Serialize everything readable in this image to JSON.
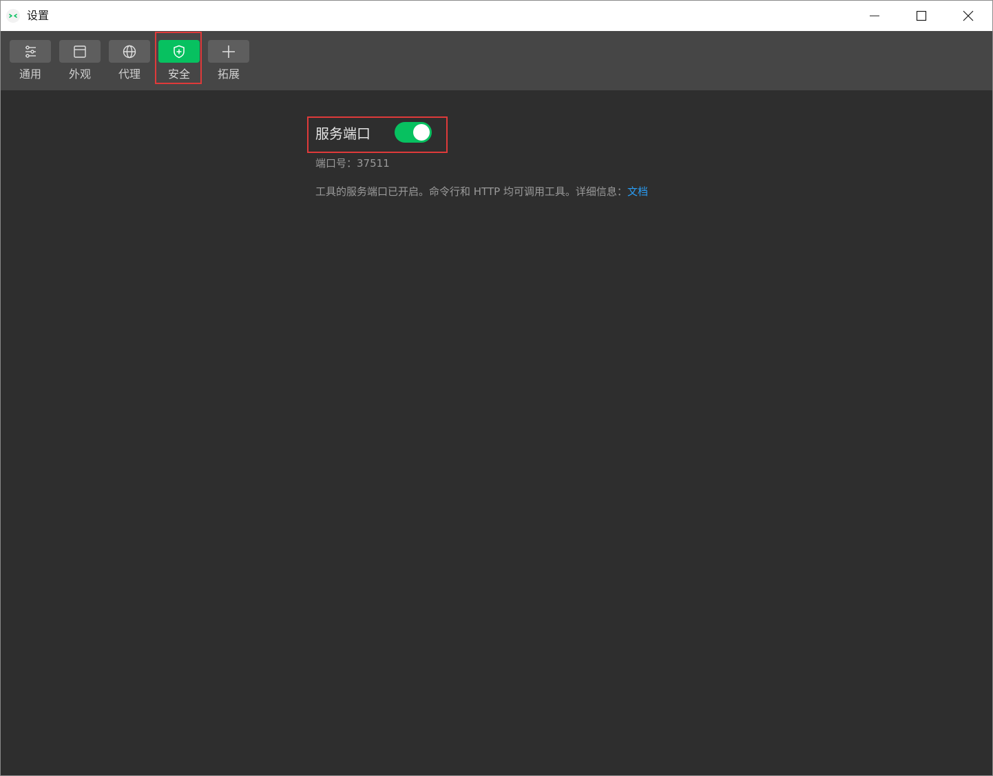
{
  "window": {
    "title": "设置",
    "app_icon": "wechat-devtools-icon"
  },
  "toolbar": {
    "tabs": [
      {
        "label": "通用",
        "icon": "sliders-icon",
        "active": false
      },
      {
        "label": "外观",
        "icon": "window-icon",
        "active": false
      },
      {
        "label": "代理",
        "icon": "globe-icon",
        "active": false
      },
      {
        "label": "安全",
        "icon": "shield-icon",
        "active": true
      },
      {
        "label": "拓展",
        "icon": "plus-icon",
        "active": false
      }
    ]
  },
  "security": {
    "service_port_label": "服务端口",
    "service_port_enabled": true,
    "port_prefix": "端口号：",
    "port_number": "37511",
    "description": "工具的服务端口已开启。命令行和 HTTP 均可调用工具。详细信息：",
    "doc_link_label": "文档"
  },
  "colors": {
    "accent": "#07c160",
    "link": "#2a9df4",
    "highlight": "#e03a3a",
    "background": "#2e2e2e",
    "toolbar": "#464646"
  }
}
